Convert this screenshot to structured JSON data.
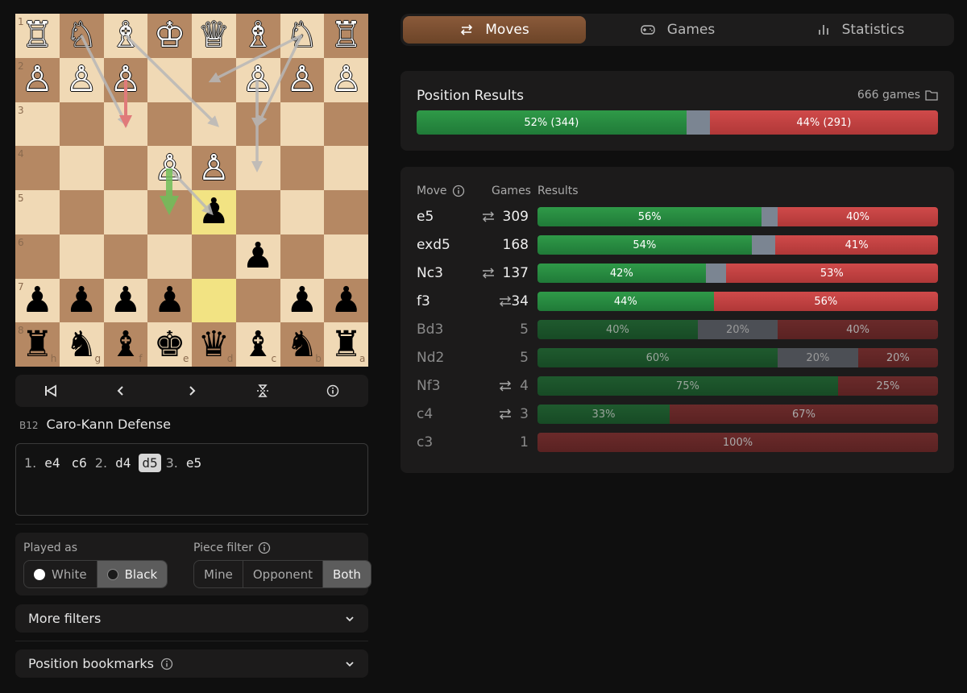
{
  "board": {
    "ranks_labels": [
      "1",
      "2",
      "3",
      "4",
      "5",
      "6",
      "7",
      "8"
    ],
    "files_labels": [
      "h",
      "g",
      "f",
      "e",
      "d",
      "c",
      "b",
      "a"
    ],
    "pieces": [
      [
        "♖",
        "♘",
        "♗",
        "♔",
        "♕",
        "♗",
        "♘",
        "♖"
      ],
      [
        "♙",
        "♙",
        "♙",
        "",
        "",
        "♙",
        "♙",
        "♙"
      ],
      [
        "",
        "",
        "",
        "",
        "",
        "",
        "",
        ""
      ],
      [
        "",
        "",
        "",
        "♙",
        "♙",
        "",
        "",
        ""
      ],
      [
        "",
        "",
        "",
        "",
        "♟",
        "",
        "",
        ""
      ],
      [
        "",
        "",
        "",
        "",
        "",
        "♟",
        "",
        ""
      ],
      [
        "♟",
        "♟",
        "♟",
        "♟",
        "",
        "",
        "♟",
        "♟"
      ],
      [
        "♜",
        "♞",
        "♝",
        "♚",
        "♛",
        "♝",
        "♞",
        "♜"
      ]
    ],
    "highlight": [
      [
        4,
        4
      ],
      [
        6,
        4
      ]
    ]
  },
  "nav": {
    "first_icon": "skip-to-start-icon",
    "prev_icon": "chevron-left-icon",
    "next_icon": "chevron-right-icon",
    "flip_icon": "flip-board-icon",
    "info_icon": "info-icon"
  },
  "opening": {
    "eco": "B12",
    "name": "Caro-Kann Defense"
  },
  "movelist": {
    "items": [
      {
        "num": "1.",
        "white": "e4",
        "black": "c6"
      },
      {
        "num": "2.",
        "white": "d4",
        "black": "d5"
      },
      {
        "num": "3.",
        "white": "e5",
        "black": ""
      }
    ],
    "current": "d5"
  },
  "filters": {
    "played_as_label": "Played as",
    "played_as_options": [
      "White",
      "Black"
    ],
    "played_as_selected": "Black",
    "piece_filter_label": "Piece filter",
    "piece_filter_options": [
      "Mine",
      "Opponent",
      "Both"
    ],
    "piece_filter_selected": "Both"
  },
  "more_filters": "More filters",
  "bookmarks": "Position bookmarks",
  "tabs": [
    {
      "label": "Moves",
      "icon": "swap-arrows-icon",
      "active": true
    },
    {
      "label": "Games",
      "icon": "gamepad-icon",
      "active": false
    },
    {
      "label": "Statistics",
      "icon": "bar-chart-icon",
      "active": false
    }
  ],
  "position_results": {
    "title": "Position Results",
    "games": "666 games",
    "win_pct": 52,
    "win_label": "52% (344)",
    "draw_pct": 4.5,
    "loss_pct": 44,
    "loss_label": "44% (291)"
  },
  "moves_table": {
    "headers": {
      "move": "Move",
      "games": "Games",
      "results": "Results"
    },
    "rows": [
      {
        "move": "e5",
        "swap": true,
        "games": "309",
        "w": 56,
        "d": 4,
        "l": 40,
        "wl": "56%",
        "dl": "",
        "ll": "40%",
        "dim": false
      },
      {
        "move": "exd5",
        "swap": false,
        "games": "168",
        "w": 54,
        "d": 6,
        "l": 41,
        "wl": "54%",
        "dl": "",
        "ll": "41%",
        "dim": false
      },
      {
        "move": "Nc3",
        "swap": true,
        "games": "137",
        "w": 42,
        "d": 5,
        "l": 53,
        "wl": "42%",
        "dl": "",
        "ll": "53%",
        "dim": false
      },
      {
        "move": "f3",
        "swap": true,
        "games": "34",
        "w": 44,
        "d": 0,
        "l": 56,
        "wl": "44%",
        "dl": "",
        "ll": "56%",
        "dim": false
      },
      {
        "move": "Bd3",
        "swap": false,
        "games": "5",
        "w": 40,
        "d": 20,
        "l": 40,
        "wl": "40%",
        "dl": "20%",
        "ll": "40%",
        "dim": true
      },
      {
        "move": "Nd2",
        "swap": false,
        "games": "5",
        "w": 60,
        "d": 20,
        "l": 20,
        "wl": "60%",
        "dl": "20%",
        "ll": "20%",
        "dim": true
      },
      {
        "move": "Nf3",
        "swap": true,
        "games": "4",
        "w": 75,
        "d": 0,
        "l": 25,
        "wl": "75%",
        "dl": "",
        "ll": "25%",
        "dim": true
      },
      {
        "move": "c4",
        "swap": true,
        "games": "3",
        "w": 33,
        "d": 0,
        "l": 67,
        "wl": "33%",
        "dl": "",
        "ll": "67%",
        "dim": true
      },
      {
        "move": "c3",
        "swap": false,
        "games": "1",
        "w": 0,
        "d": 0,
        "l": 100,
        "wl": "",
        "dl": "",
        "ll": "100%",
        "dim": true
      }
    ]
  }
}
